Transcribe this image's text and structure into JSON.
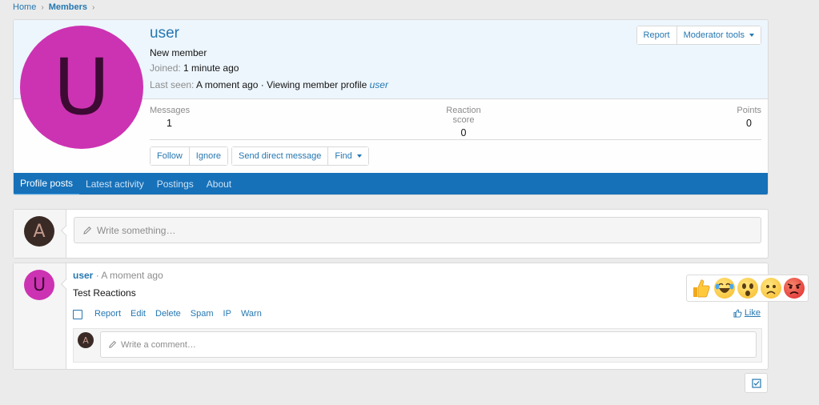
{
  "breadcrumb": {
    "items": [
      "Home",
      "Members"
    ]
  },
  "profile": {
    "avatar_letter": "U",
    "avatar_color": "#cc33b2",
    "username": "user",
    "title": "New member",
    "joined_label": "Joined:",
    "joined_value": "1 minute ago",
    "lastseen_label": "Last seen:",
    "lastseen_value": "A moment ago · Viewing member profile",
    "lastseen_link": "user",
    "buttons": {
      "report": "Report",
      "moderator_tools": "Moderator tools"
    },
    "stats": {
      "messages_label": "Messages",
      "messages_value": "1",
      "reaction_label": "Reaction score",
      "reaction_value": "0",
      "points_label": "Points",
      "points_value": "0"
    },
    "actions": {
      "follow": "Follow",
      "ignore": "Ignore",
      "send_dm": "Send direct message",
      "find": "Find"
    },
    "tabs": [
      "Profile posts",
      "Latest activity",
      "Postings",
      "About"
    ]
  },
  "composer": {
    "avatar_letter": "A",
    "placeholder": "Write something…"
  },
  "post": {
    "avatar_letter": "U",
    "author": "user",
    "time": "· A moment ago",
    "body": "Test Reactions",
    "actions": [
      "Report",
      "Edit",
      "Delete",
      "Spam",
      "IP",
      "Warn"
    ],
    "like_label": "Like",
    "comment_avatar_letter": "A",
    "comment_placeholder": "Write a comment…"
  },
  "reactions": [
    "like-icon",
    "laughing-icon",
    "wow-icon",
    "sad-icon",
    "angry-icon"
  ],
  "colors": {
    "accent": "#2577b1",
    "tabs_bar": "#1771b9",
    "header_bg": "#edf6fd"
  }
}
